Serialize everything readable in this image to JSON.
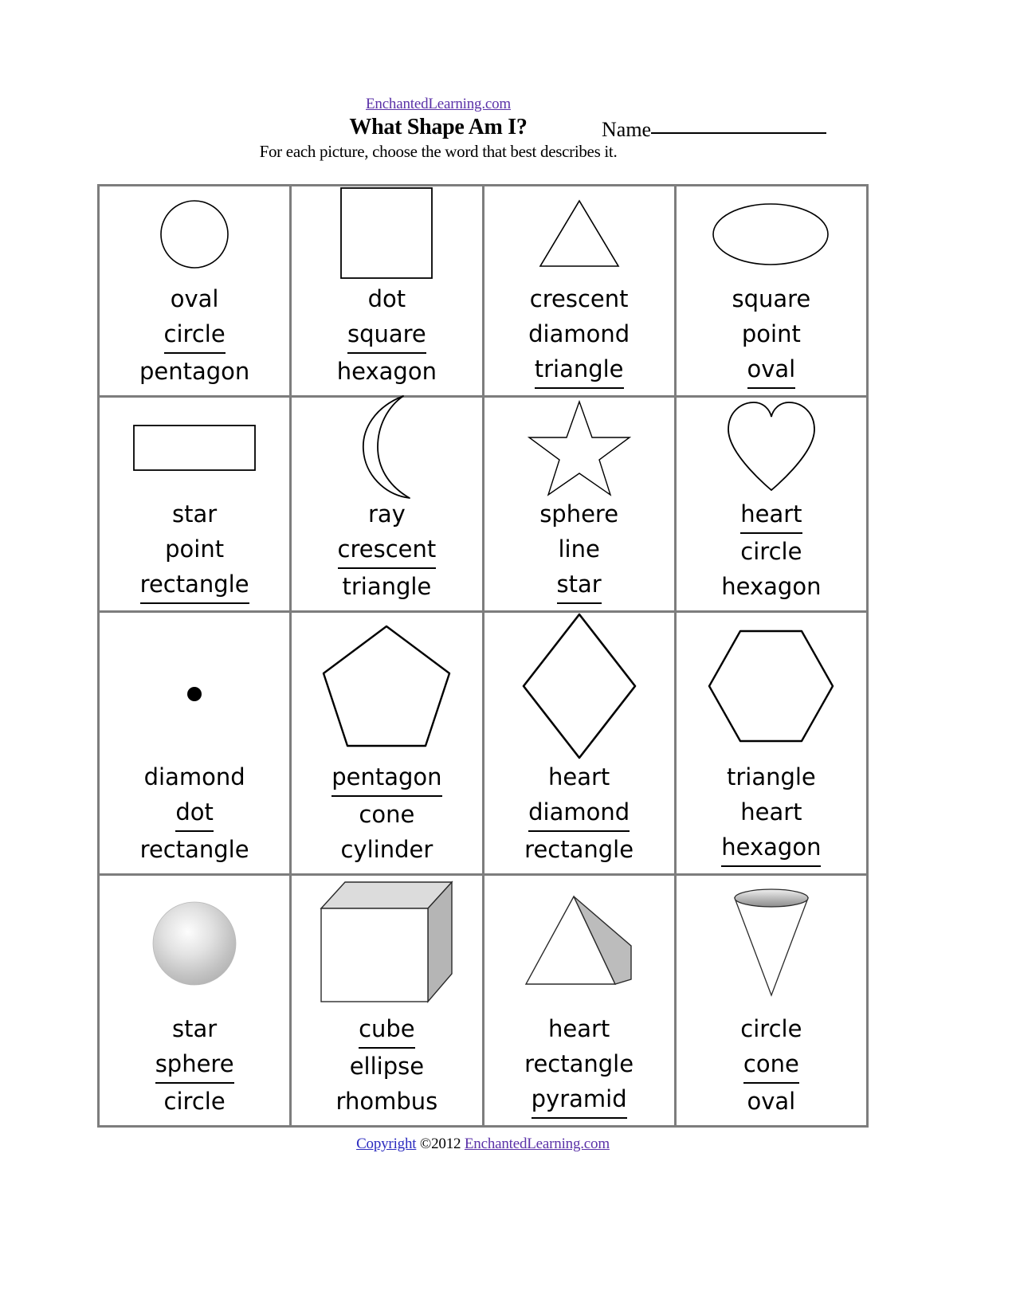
{
  "header": {
    "site_link": "EnchantedLearning.com",
    "title": "What Shape Am I?",
    "instructions": "For each picture, choose the word that best describes it.",
    "name_label": "Name"
  },
  "footer": {
    "copyright_word": "Copyright",
    "copyright_symbol_year": "©2012",
    "site": "EnchantedLearning.com"
  },
  "colors": {
    "link_purple": "#5b32a8",
    "link_blue": "#2b2bbf",
    "grid_border": "#7d7d7d",
    "shape_stroke": "#000000",
    "shade_gray": "#c8c8c8"
  },
  "cells": [
    {
      "icon": "circle-shape",
      "options": [
        {
          "label": "oval",
          "answer": false
        },
        {
          "label": "circle",
          "answer": true
        },
        {
          "label": "pentagon",
          "answer": false
        }
      ]
    },
    {
      "icon": "square-shape",
      "options": [
        {
          "label": "dot",
          "answer": false
        },
        {
          "label": "square",
          "answer": true
        },
        {
          "label": "hexagon",
          "answer": false
        }
      ]
    },
    {
      "icon": "triangle-shape",
      "options": [
        {
          "label": "crescent",
          "answer": false
        },
        {
          "label": "diamond",
          "answer": false
        },
        {
          "label": "triangle",
          "answer": true
        }
      ]
    },
    {
      "icon": "oval-shape",
      "options": [
        {
          "label": "square",
          "answer": false
        },
        {
          "label": "point",
          "answer": false
        },
        {
          "label": "oval",
          "answer": true
        }
      ]
    },
    {
      "icon": "rectangle-shape",
      "options": [
        {
          "label": "star",
          "answer": false
        },
        {
          "label": "point",
          "answer": false
        },
        {
          "label": "rectangle",
          "answer": true
        }
      ]
    },
    {
      "icon": "crescent-shape",
      "options": [
        {
          "label": "ray",
          "answer": false
        },
        {
          "label": "crescent",
          "answer": true
        },
        {
          "label": "triangle",
          "answer": false
        }
      ]
    },
    {
      "icon": "star-shape",
      "options": [
        {
          "label": "sphere",
          "answer": false
        },
        {
          "label": "line",
          "answer": false
        },
        {
          "label": "star",
          "answer": true
        }
      ]
    },
    {
      "icon": "heart-shape",
      "options": [
        {
          "label": "heart",
          "answer": true
        },
        {
          "label": "circle",
          "answer": false
        },
        {
          "label": "hexagon",
          "answer": false
        }
      ]
    },
    {
      "icon": "dot-shape",
      "options": [
        {
          "label": "diamond",
          "answer": false
        },
        {
          "label": "dot",
          "answer": true
        },
        {
          "label": "rectangle",
          "answer": false
        }
      ]
    },
    {
      "icon": "pentagon-shape",
      "options": [
        {
          "label": "pentagon",
          "answer": true
        },
        {
          "label": "cone",
          "answer": false
        },
        {
          "label": "cylinder",
          "answer": false
        }
      ]
    },
    {
      "icon": "diamond-shape",
      "options": [
        {
          "label": "heart",
          "answer": false
        },
        {
          "label": "diamond",
          "answer": true
        },
        {
          "label": "rectangle",
          "answer": false
        }
      ]
    },
    {
      "icon": "hexagon-shape",
      "options": [
        {
          "label": "triangle",
          "answer": false
        },
        {
          "label": "heart",
          "answer": false
        },
        {
          "label": "hexagon",
          "answer": true
        }
      ]
    },
    {
      "icon": "sphere-shape",
      "options": [
        {
          "label": "star",
          "answer": false
        },
        {
          "label": "sphere",
          "answer": true
        },
        {
          "label": "circle",
          "answer": false
        }
      ]
    },
    {
      "icon": "cube-shape",
      "options": [
        {
          "label": "cube",
          "answer": true
        },
        {
          "label": "ellipse",
          "answer": false
        },
        {
          "label": "rhombus",
          "answer": false
        }
      ]
    },
    {
      "icon": "pyramid-shape",
      "options": [
        {
          "label": "heart",
          "answer": false
        },
        {
          "label": "rectangle",
          "answer": false
        },
        {
          "label": "pyramid",
          "answer": true
        }
      ]
    },
    {
      "icon": "cone-shape",
      "options": [
        {
          "label": "circle",
          "answer": false
        },
        {
          "label": "cone",
          "answer": true
        },
        {
          "label": "oval",
          "answer": false
        }
      ]
    }
  ]
}
